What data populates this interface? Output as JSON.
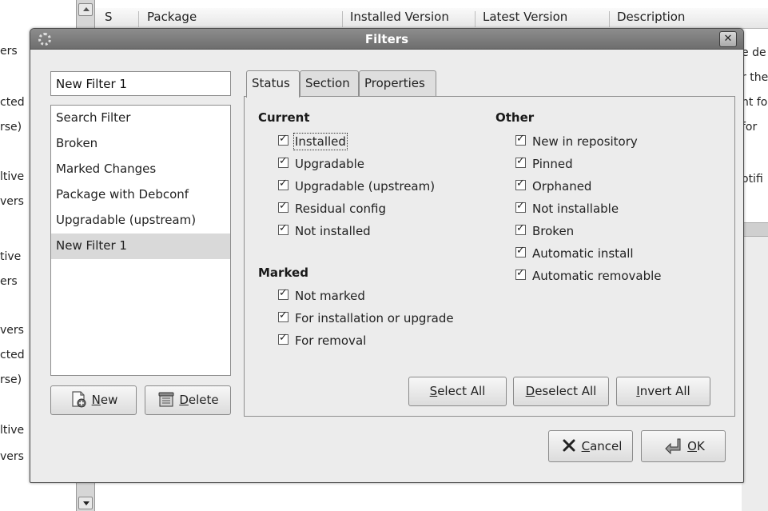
{
  "background": {
    "left_fragments": [
      "ers",
      "cted",
      "rse)",
      "ltive",
      "vers",
      "tive",
      "ers",
      "vers",
      "cted",
      "rse)",
      "ltive",
      "vers"
    ],
    "columns": [
      "S",
      "Package",
      "Installed Version",
      "Latest Version",
      "Description"
    ],
    "right_fragments": [
      "e de",
      "r the",
      "nt fo",
      "for ",
      "otifi"
    ]
  },
  "dialog": {
    "title": "Filters",
    "close_glyph": "✕",
    "filter_name_value": "New Filter 1",
    "filters": [
      "Search Filter",
      "Broken",
      "Marked Changes",
      "Package with Debconf",
      "Upgradable (upstream)",
      "New Filter 1"
    ],
    "selected_filter_index": 5,
    "new_button": {
      "mnemonic": "N",
      "rest": "ew",
      "icon": "new-document-icon"
    },
    "delete_button": {
      "mnemonic": "D",
      "rest": "elete",
      "icon": "trash-icon"
    },
    "tabs": [
      "Status",
      "Section",
      "Properties"
    ],
    "active_tab_index": 0,
    "status": {
      "current_title": "Current",
      "current": [
        "Installed",
        "Upgradable",
        "Upgradable (upstream)",
        "Residual config",
        "Not installed"
      ],
      "marked_title": "Marked",
      "marked": [
        "Not marked",
        "For installation or upgrade",
        "For removal"
      ],
      "other_title": "Other",
      "other": [
        "New in repository",
        "Pinned",
        "Orphaned",
        "Not installable",
        "Broken",
        "Automatic install",
        "Automatic removable"
      ]
    },
    "select_all": {
      "mnemonic": "S",
      "rest": "elect All"
    },
    "deselect_all": {
      "mnemonic": "D",
      "rest": "eselect All"
    },
    "invert_all": {
      "mnemonic": "I",
      "rest": "nvert All"
    },
    "cancel_button": {
      "mnemonic": "C",
      "rest": "ancel",
      "icon": "cancel-x-icon"
    },
    "ok_button": {
      "mnemonic": "O",
      "rest": "K",
      "icon": "return-arrow-icon"
    }
  }
}
